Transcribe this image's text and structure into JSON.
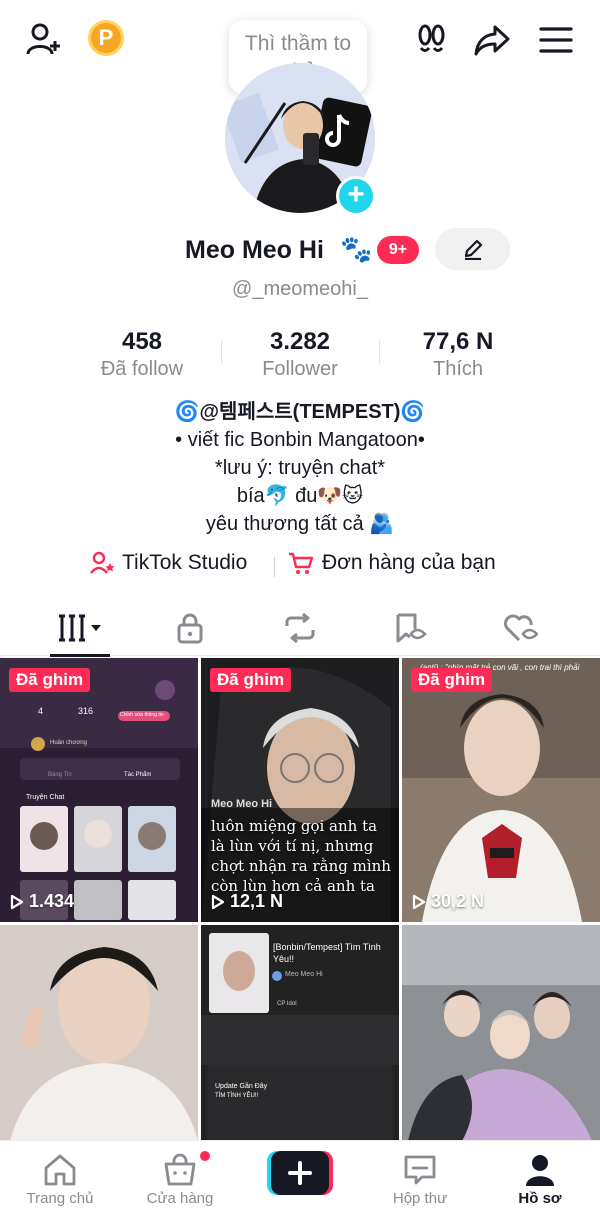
{
  "top_bar": {
    "tooltip": "Thì thầm to nhỏ",
    "coin_letter": "P"
  },
  "profile": {
    "name": "Meo Meo Hi",
    "name_emoji": "🐾",
    "notif_badge": "9+",
    "handle": "@_meomeohi_"
  },
  "stats": [
    {
      "value": "458",
      "label": "Đã follow"
    },
    {
      "value": "3.282",
      "label": "Follower"
    },
    {
      "value": "77,6 N",
      "label": "Thích"
    }
  ],
  "bio": [
    "🌀@템페스트(TEMPEST)🌀",
    "• viết fic Bonbin Mangatoon•",
    "*lưu ý: truyện chat*",
    "bía🐬 đu🐶🐱",
    "yêu thương tất cả 🫂"
  ],
  "links": {
    "studio": "TikTok Studio",
    "orders": "Đơn hàng của bạn"
  },
  "videos": [
    {
      "pinned": "Đã ghim",
      "views": "1.434"
    },
    {
      "pinned": "Đã ghim",
      "views": "12,1 N",
      "overlay_user": "Meo Meo Hi",
      "caption": "luôn miệng gọi anh ta là lùn với tí nị, nhưng chợt nhận ra rằng mình còn lùn hơn cả anh ta 🤡..."
    },
    {
      "pinned": "Đã ghim",
      "views": "30,2 N",
      "caption_top": "(anti) : \"nhìn mặt trẻ con vãi , con trai thì phải mạnh mẽ tí nào...\""
    },
    {},
    {
      "title": "[Bonbin/Tempest] Tìm Tình Yêu!!",
      "author": "Meo Meo Hi",
      "tag": "CP Idol",
      "update_label": "Update Gần Đây",
      "update_text": "TÌM TÌNH YÊU!!"
    },
    {}
  ],
  "first_thumb": {
    "stat_a": "4",
    "stat_b": "316",
    "button": "Chỉnh sửa thông tin",
    "medal": "Huân chương",
    "tab_a": "Bảng Tin",
    "tab_b": "Tác Phẩm",
    "section": "Truyện Chat"
  },
  "bottom_nav": {
    "home": "Trang chủ",
    "shop": "Cửa hàng",
    "inbox": "Hộp thư",
    "profile": "Hồ sơ"
  },
  "colors": {
    "accent": "#fe2c55",
    "cyan": "#20d5ec",
    "text": "#161823",
    "muted": "#8a8b91"
  },
  "icons": [
    "add-friend-icon",
    "coin-icon",
    "footprints-icon",
    "share-icon",
    "menu-icon",
    "edit-icon",
    "grid-icon",
    "lock-icon",
    "repost-icon",
    "saved-icon",
    "liked-icon",
    "play-icon",
    "home-icon",
    "shop-icon",
    "create-icon",
    "inbox-icon",
    "profile-icon"
  ]
}
